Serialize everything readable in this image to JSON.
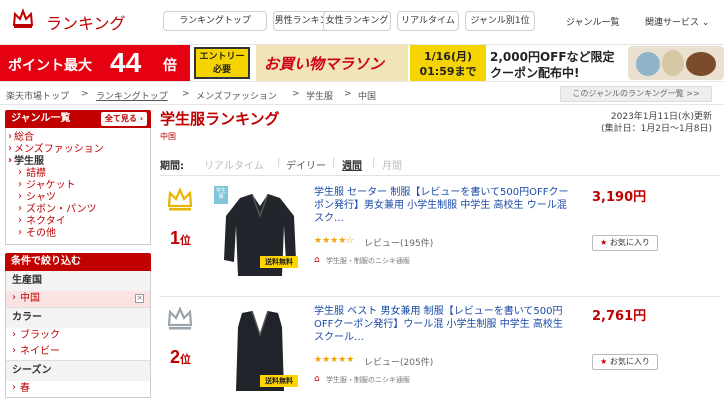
{
  "header": {
    "logo_text": "ランキング",
    "nav": [
      "ランキングトップ",
      "男性ランキング",
      "女性ランキング",
      "リアルタイム",
      "ジャンル別1位"
    ],
    "genre_list": "ジャンル一覧",
    "related": "関連サービス"
  },
  "banner": {
    "point_prefix": "ポイント最大",
    "point_num": "44",
    "point_suffix": "倍",
    "entry": "エントリー必要",
    "marathon": "お買い物マラソン",
    "date": "1/16(月)",
    "time": "01:59まで",
    "coupon_line1": "2,000円OFFなど限定",
    "coupon_line2": "クーポン配布中!"
  },
  "breadcrumb": [
    "楽天市場トップ",
    "ランキングトップ",
    "メンズファッション",
    "学生服",
    "中国"
  ],
  "genre_ranking_all": "このジャンルのランキング一覧 >>",
  "sidebar": {
    "genre_head": "ジャンル一覧",
    "see_all": "全て見る",
    "genres": [
      {
        "label": "総合",
        "level": 0
      },
      {
        "label": "メンズファッション",
        "level": 0
      },
      {
        "label": "学生服",
        "level": 0,
        "current": true
      },
      {
        "label": "詰襟",
        "level": 1
      },
      {
        "label": "ジャケット",
        "level": 1
      },
      {
        "label": "シャツ",
        "level": 1
      },
      {
        "label": "ズボン・パンツ",
        "level": 1
      },
      {
        "label": "ネクタイ",
        "level": 1
      },
      {
        "label": "その他",
        "level": 1
      }
    ],
    "filter_head": "条件で絞り込む",
    "country_title": "生産国",
    "country_selected": "中国",
    "color_title": "カラー",
    "colors": [
      "ブラック",
      "ネイビー"
    ],
    "season_title": "シーズン",
    "seasons": [
      "春"
    ]
  },
  "main": {
    "title": "学生服ランキング",
    "subgenre": "中国",
    "updated_line1": "2023年1月11日(水)更新",
    "updated_line2": "(集計日：1月2日～1月8日)",
    "period_label": "期間:",
    "periods": [
      "リアルタイム",
      "デイリー",
      "週間",
      "月間"
    ],
    "active_period": "週間"
  },
  "items": [
    {
      "rank": "1",
      "rank_suffix": "位",
      "title": "学生服 セーター 制服【レビューを書いて500円OFFクーポン発行】男女兼用 小学生制服 中学生 高校生 ウール混 スク…",
      "rating": 4.0,
      "stars": "★★★★☆",
      "reviews": "レビュー(195件)",
      "shop": "学生服・制服のニシキ通販",
      "price": "3,190円",
      "fav": "お気に入り",
      "ship": "送料無料",
      "tag": "学生服"
    },
    {
      "rank": "2",
      "rank_suffix": "位",
      "title": "学生服 ベスト 男女兼用 制服【レビューを書いて500円OFFクーポン発行】ウール混 小学生制服 中学生 高校生 スクール…",
      "rating": 4.5,
      "stars": "★★★★★",
      "reviews": "レビュー(205件)",
      "shop": "学生服・制服のニシキ通販",
      "price": "2,761円",
      "fav": "お気に入り",
      "ship": "送料無料",
      "tag": "学生服"
    }
  ]
}
